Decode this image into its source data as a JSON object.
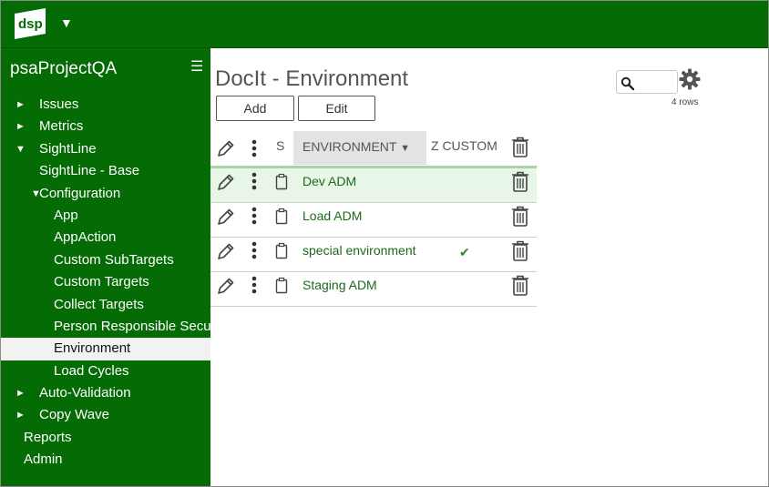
{
  "header": {
    "logo_text": "dsp",
    "logo_menu_icon": "caret-down-icon"
  },
  "sidebar": {
    "project_title": "psaProjectQA",
    "menu_icon": "hamburger-icon",
    "items": [
      {
        "label": "Issues",
        "level": 0,
        "arrow": "►"
      },
      {
        "label": "Metrics",
        "level": 0,
        "arrow": "►"
      },
      {
        "label": "SightLine",
        "level": 0,
        "arrow": "▼"
      },
      {
        "label": "SightLine - Base",
        "level": 1,
        "arrow": ""
      },
      {
        "label": "Configuration",
        "level": 1,
        "arrow": "▼"
      },
      {
        "label": "App",
        "level": 2,
        "arrow": ""
      },
      {
        "label": "AppAction",
        "level": 2,
        "arrow": ""
      },
      {
        "label": "Custom SubTargets",
        "level": 2,
        "arrow": ""
      },
      {
        "label": "Custom Targets",
        "level": 2,
        "arrow": ""
      },
      {
        "label": "Collect Targets",
        "level": 2,
        "arrow": ""
      },
      {
        "label": "Person Responsible Security",
        "level": 2,
        "arrow": ""
      },
      {
        "label": "Environment",
        "level": 2,
        "arrow": "",
        "active": true
      },
      {
        "label": "Load Cycles",
        "level": 2,
        "arrow": ""
      },
      {
        "label": "Auto-Validation",
        "level": 0,
        "arrow": "►"
      },
      {
        "label": "Copy Wave",
        "level": 0,
        "arrow": "►"
      },
      {
        "label": "Reports",
        "level": -1,
        "arrow": ""
      },
      {
        "label": "Admin",
        "level": -1,
        "arrow": ""
      }
    ]
  },
  "main": {
    "title": "DocIt - Environment",
    "buttons": {
      "add": "Add",
      "edit": "Edit"
    },
    "search": {
      "value": "",
      "placeholder": ""
    },
    "rows_count": "4 rows"
  },
  "table": {
    "columns": {
      "s": "S",
      "environment": "ENVIRONMENT",
      "environment_sort_icon": "sort-down-icon",
      "z_custom": "Z CUSTOM"
    },
    "rows": [
      {
        "environment": "Dev ADM",
        "z_custom": ""
      },
      {
        "environment": "Load ADM",
        "z_custom": ""
      },
      {
        "environment": "special environment",
        "z_custom": "✔"
      },
      {
        "environment": "Staging ADM",
        "z_custom": ""
      }
    ]
  },
  "colors": {
    "brand_green": "#056b05",
    "row_highlight": "#e8f6e8",
    "link_green": "#1b6a1b"
  }
}
